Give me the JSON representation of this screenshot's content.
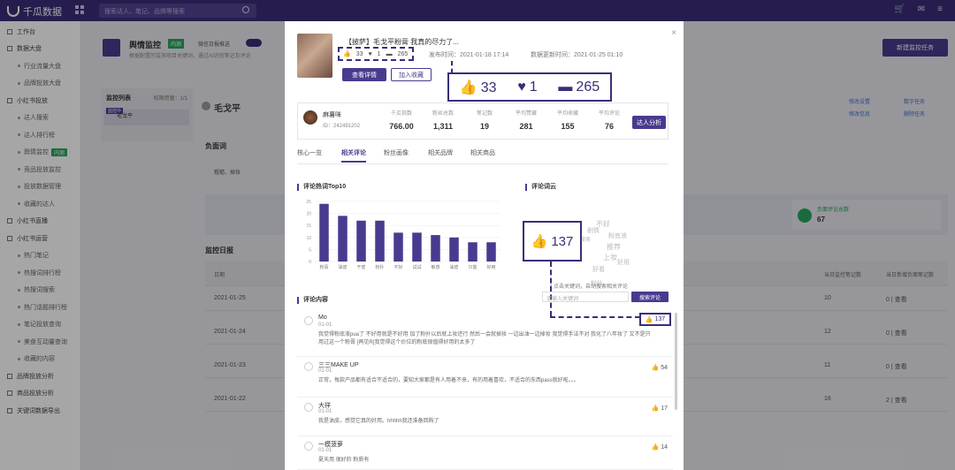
{
  "topbar": {
    "brand": "千瓜数据",
    "search_placeholder": "搜索达人、笔记、品牌等搜索",
    "icons": [
      "cart-icon",
      "mail-icon",
      "menu-icon"
    ]
  },
  "sidebar": {
    "items": [
      {
        "label": "工作台",
        "sub": false
      },
      {
        "label": "数据大盘",
        "sub": false
      },
      {
        "label": "行业流量大盘",
        "sub": true
      },
      {
        "label": "品牌投放大盘",
        "sub": true
      },
      {
        "label": "小红书投放",
        "sub": false
      },
      {
        "label": "达人搜索",
        "sub": true
      },
      {
        "label": "达人排行榜",
        "sub": true
      },
      {
        "label": "舆情监控",
        "sub": true,
        "badge": "内测"
      },
      {
        "label": "竞品投放监控",
        "sub": true
      },
      {
        "label": "投放数据管理",
        "sub": true
      },
      {
        "label": "收藏的达人",
        "sub": true
      },
      {
        "label": "小红书直播",
        "sub": false
      },
      {
        "label": "小红书运营",
        "sub": false
      },
      {
        "label": "热门笔记",
        "sub": true
      },
      {
        "label": "热搜词排行榜",
        "sub": true
      },
      {
        "label": "热搜词搜索",
        "sub": true
      },
      {
        "label": "热门话题排行榜",
        "sub": true
      },
      {
        "label": "笔记投放查询",
        "sub": true
      },
      {
        "label": "美食互动量查询",
        "sub": true
      },
      {
        "label": "收藏的内容",
        "sub": true
      },
      {
        "label": "品牌投放分析",
        "sub": false
      },
      {
        "label": "商品投放分析",
        "sub": false
      },
      {
        "label": "关键词数据导出",
        "sub": false
      }
    ]
  },
  "main": {
    "title": "舆情监控",
    "title_badge": "内测",
    "subtitle": "根据配置的监测项目关键词，通过AI识别笔记及评论",
    "option_wechat": "微信日报推送",
    "option_on": "已开启",
    "new_button": "新建监控任务",
    "list_title": "监控列表",
    "list_quota": "权限用量：1/1",
    "list_tag": "监控中",
    "list_item": "毛戈平",
    "name": "毛戈平",
    "neg_title": "负面词",
    "neg_words": "粗糙、掉妆",
    "daily_title": "监控日报",
    "links": [
      "修改设置",
      "数字任务",
      "修改信息",
      "删除任务"
    ],
    "stat_label": "负面评论总数",
    "stat_value": "67",
    "table_headers": [
      "日期",
      "当日监控笔记数",
      "当日新增负面笔记数",
      "当日新增负面评论数"
    ],
    "rows": [
      {
        "date": "2021-01-25",
        "notes": "10",
        "neg_notes": "0 | 查看",
        "neg_comments": "0 | 查看"
      },
      {
        "date": "2021-01-24",
        "notes": "12",
        "neg_notes": "0 | 查看",
        "neg_comments": "3 | 查看"
      },
      {
        "date": "2021-01-23",
        "notes": "11",
        "neg_notes": "0 | 查看",
        "neg_comments": "0 | 查看"
      },
      {
        "date": "2021-01-22",
        "notes": "16",
        "neg_notes": "2 | 查看",
        "neg_comments": "64 | 查看"
      }
    ]
  },
  "modal": {
    "note_title": "【披萨】毛戈平粉膏 我真的尽力了...",
    "likes": "33",
    "collects": "1",
    "comments": "265",
    "publish_time": "发布时间：2021-01-18 17:14",
    "update_time": "数据更新时间：2021-01-25 01:10",
    "detail_button": "查看详情",
    "fav_button": "加入收藏",
    "author": {
      "name": "麻薯咪",
      "id": "ID：242491202",
      "metrics": [
        {
          "label": "千瓜指数",
          "value": "766.00"
        },
        {
          "label": "粉丝总数",
          "value": "1,311"
        },
        {
          "label": "笔记数",
          "value": "19"
        },
        {
          "label": "平均赞藏",
          "value": "281"
        },
        {
          "label": "平均收藏",
          "value": "155"
        },
        {
          "label": "平均评论",
          "value": "76"
        }
      ],
      "analyze_button": "达人分析"
    },
    "tabs": [
      "核心一览",
      "相关评论",
      "粉丝画像",
      "相关品牌",
      "相关商品"
    ],
    "active_tab": 1,
    "hot_words_title": "评论热词Top10",
    "cloud_title": "评论词云",
    "cloud_words": [
      "不好",
      "剧情",
      "粉底液",
      "搜索",
      "推荐",
      "上妆",
      "好用",
      "好看",
      "粉扑"
    ],
    "cloud_highlight_likes": "137",
    "keyword_hint": "* 点击关键词，自动搜索相关评论",
    "keyword_placeholder": "请输入关键词",
    "keyword_button": "搜索评论",
    "comments_title": "评论内容",
    "comment_list": [
      {
        "name": "Mo",
        "date": "01-01",
        "text": "我觉得粉底液pua了 不好用就是不好用 加了粉扑以后就上妆还行 然后一会就掉妆 一边出油一边掉妆 我觉得手法不对 我化了八年妆了 又不是只用过这一个粉膏 [再见R]我觉得这个价位的粉底很值得好用的太多了",
        "likes": "137"
      },
      {
        "name": "三三MAKE UP",
        "date": "01-01",
        "text": "正常，每款产品都有适合不适合的，要知大家都是有人用着不来，有的用着喜欢，不适合的东西pass就好啦。。。",
        "likes": "54"
      },
      {
        "name": "大祥",
        "date": "01-01",
        "text": "我是油皮，感觉它真的好用。hhhhh我还准备回购了",
        "likes": "17"
      },
      {
        "name": "一模菠萝",
        "date": "01-01",
        "text": "夏天用 很好的 粉质有",
        "likes": "14"
      }
    ]
  },
  "chart_data": {
    "type": "bar",
    "title": "评论热词Top10",
    "categories": [
      "粉膏",
      "油皮",
      "干皮",
      "粉扑",
      "不好",
      "试试",
      "敏感",
      "油皮",
      "只能",
      "好用"
    ],
    "values": [
      24,
      19,
      17,
      17,
      12,
      12,
      11,
      10,
      8,
      8
    ],
    "ylim": [
      0,
      25
    ],
    "yticks": [
      0,
      5,
      10,
      15,
      20,
      25
    ],
    "grid": true,
    "color": "#4a3a8f"
  },
  "colors": {
    "accent": "#4a3a8f",
    "topbar": "#3b2d78",
    "green": "#27a55c"
  }
}
